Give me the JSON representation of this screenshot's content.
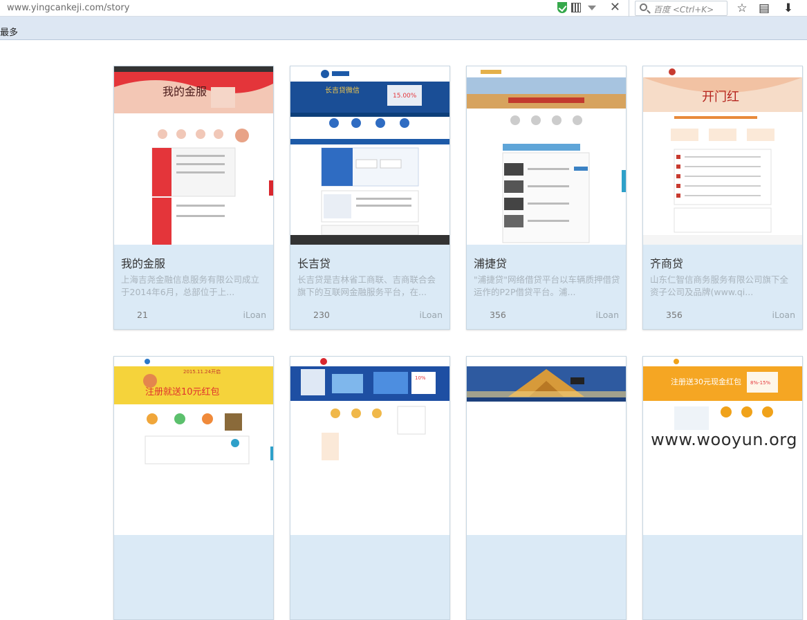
{
  "browser": {
    "url": "www.yingcankeji.com/story",
    "search_placeholder": "百度 <Ctrl+K>",
    "close_symbol": "✕",
    "star_icon": "☆",
    "menu_icon": "▤",
    "download_icon": "⬇"
  },
  "bookmarks": {
    "label": "最多"
  },
  "cards": [
    {
      "title": "我的金服",
      "desc": "上海吉尧金融信息服务有限公司成立于2014年6月，总部位于上...",
      "count": "21",
      "tag": "iLoan",
      "theme": "#d9272e"
    },
    {
      "title": "长吉贷",
      "desc": "长吉贷是吉林省工商联、吉商联合会旗下的互联网金融服务平台，在...",
      "count": "230",
      "tag": "iLoan",
      "theme": "#1d5aa8"
    },
    {
      "title": "浦捷贷",
      "desc": "\"浦捷贷\"网络借贷平台以车辆质押借贷运作的P2P借贷平台。浦...",
      "count": "356",
      "tag": "iLoan",
      "theme": "#e4b04a"
    },
    {
      "title": "齐商贷",
      "desc": "山东仁智信商务服务有限公司旗下全资子公司及品牌(www.qi...",
      "count": "356",
      "tag": "iLoan",
      "theme": "#c73a2f"
    },
    {
      "title": "",
      "desc": "",
      "count": "",
      "tag": "",
      "theme": "#f2c428"
    },
    {
      "title": "",
      "desc": "",
      "count": "",
      "tag": "",
      "theme": "#1e4fa3"
    },
    {
      "title": "",
      "desc": "",
      "count": "",
      "tag": "",
      "theme": "#c98a1f"
    },
    {
      "title": "",
      "desc": "",
      "count": "",
      "tag": "",
      "theme": "#f0a21a"
    }
  ],
  "thumb_text": {
    "card1_banner": "我的金服",
    "card2_banner": "长吉贷微信",
    "card2_rate": "15.00%",
    "card4_banner": "开门红",
    "card5_banner": "注册就送10元红包",
    "card5_date": "2015.11.24开启",
    "card6_rate": "10%",
    "card8_banner": "注册送30元现金红包",
    "card8_rate": "8%-15%"
  },
  "watermark": "www.wooyun.org"
}
